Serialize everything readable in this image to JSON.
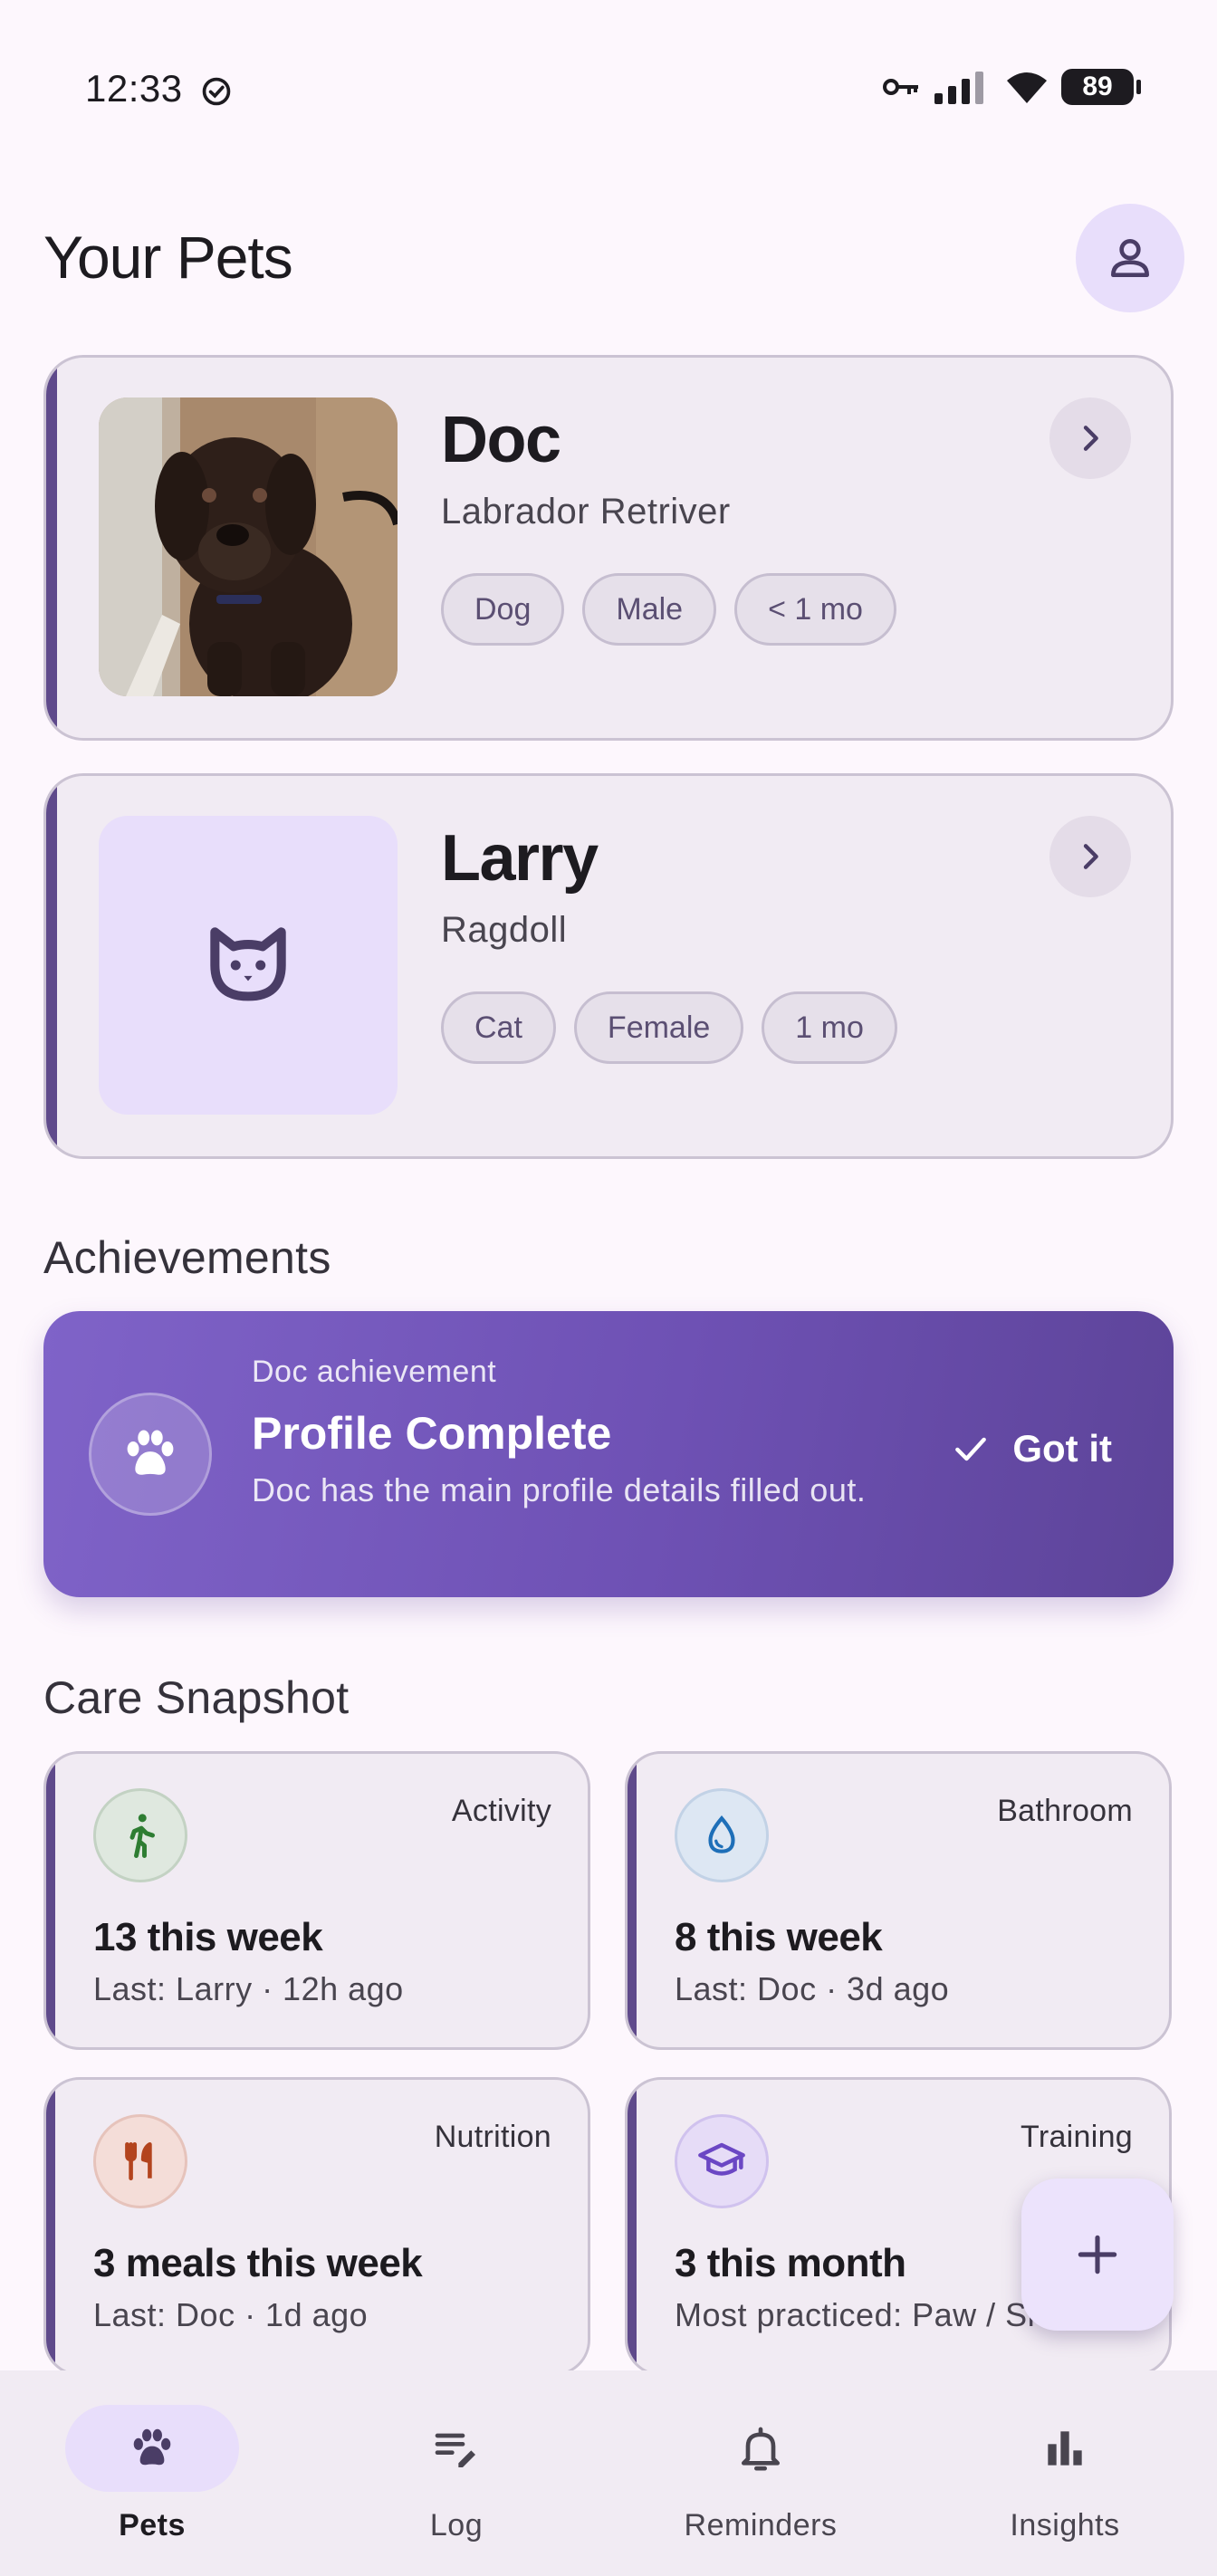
{
  "status_bar": {
    "time": "12:33",
    "battery": "89"
  },
  "header": {
    "title": "Your Pets"
  },
  "pets": [
    {
      "name": "Doc",
      "breed": "Labrador Retriver",
      "chips": [
        "Dog",
        "Male",
        "< 1 mo"
      ]
    },
    {
      "name": "Larry",
      "breed": "Ragdoll",
      "chips": [
        "Cat",
        "Female",
        "1 mo"
      ]
    }
  ],
  "achievements": {
    "section_title": "Achievements",
    "kicker": "Doc achievement",
    "title": "Profile Complete",
    "description": "Doc has the main profile details filled out.",
    "action_label": "Got it"
  },
  "care_snapshot": {
    "section_title": "Care Snapshot",
    "cards": [
      {
        "category": "Activity",
        "main": "13 this week",
        "sub": "Last: Larry · 12h ago",
        "icon": "walk-icon",
        "icon_color": "#2e7d32",
        "icon_bg": "#dfe8df"
      },
      {
        "category": "Bathroom",
        "main": "8 this week",
        "sub": "Last: Doc · 3d ago",
        "icon": "water-drop-icon",
        "icon_color": "#1e6fb8",
        "icon_bg": "#dde7f3"
      },
      {
        "category": "Nutrition",
        "main": "3 meals this week",
        "sub": "Last: Doc · 1d ago",
        "icon": "fork-knife-icon",
        "icon_color": "#b3441e",
        "icon_bg": "#f4ddd8"
      },
      {
        "category": "Training",
        "main": "3 this month",
        "sub": "Most practiced: Paw / Shake",
        "icon": "graduation-cap-icon",
        "icon_color": "#6b47c4",
        "icon_bg": "#e6dcf7"
      }
    ]
  },
  "bottom_nav": [
    {
      "label": "Pets",
      "icon": "paw-icon",
      "active": true
    },
    {
      "label": "Log",
      "icon": "edit-note-icon",
      "active": false
    },
    {
      "label": "Reminders",
      "icon": "bell-icon",
      "active": false
    },
    {
      "label": "Insights",
      "icon": "bar-chart-icon",
      "active": false
    }
  ],
  "colors": {
    "accent": "#5f4a8b",
    "achievement_start": "#7f63c8",
    "achievement_end": "#5d4499",
    "background": "#fdf7fd"
  }
}
